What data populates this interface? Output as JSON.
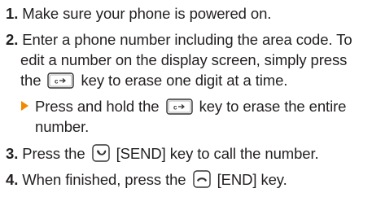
{
  "steps": {
    "s1": {
      "num": "1.",
      "text": "Make sure your phone is powered on."
    },
    "s2": {
      "num": "2.",
      "line1": "Enter a phone number including the area code. To",
      "line2": "edit a number on the display screen, simply press",
      "line3a": "the",
      "line3b": "key to erase one digit at a time."
    },
    "sub": {
      "line1a": "Press and hold the",
      "line1b": "key to erase the entire",
      "line2": "number."
    },
    "s3": {
      "num": "3.",
      "a": "Press the",
      "b": "[SEND] key to call the number."
    },
    "s4": {
      "num": "4.",
      "a": "When finished, press the",
      "b": "[END] key."
    }
  },
  "icons": {
    "clear_key": "clear-key-icon",
    "send_key": "send-key-icon",
    "end_key": "end-key-icon",
    "bullet": "triangle-bullet-icon"
  },
  "colors": {
    "bullet": "#f08a00",
    "text": "#231f20",
    "key_stroke": "#333333"
  }
}
